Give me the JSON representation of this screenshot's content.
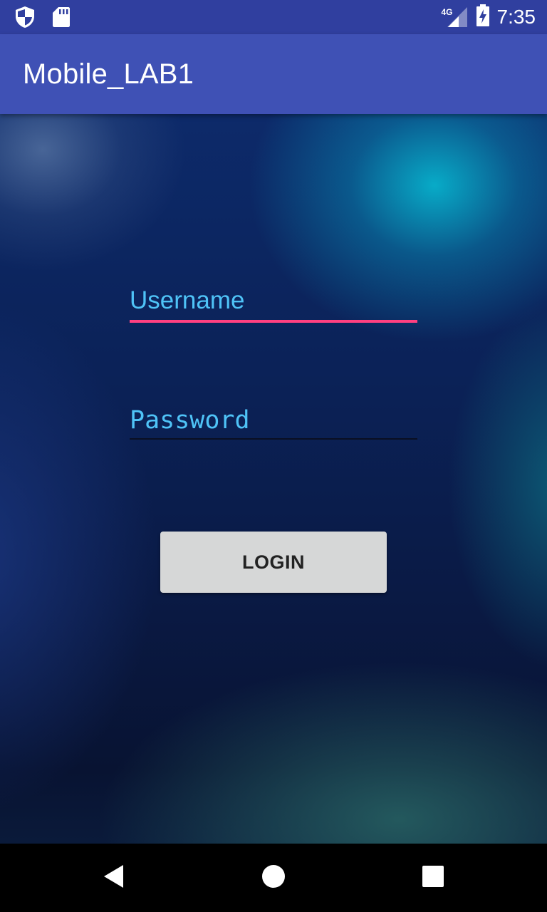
{
  "status_bar": {
    "time": "7:35",
    "network_label": "4G",
    "icons": [
      "shield-icon",
      "sd-card-icon",
      "signal-icon",
      "battery-charging-icon"
    ]
  },
  "app_bar": {
    "title": "Mobile_LAB1",
    "color": "#3f51b5"
  },
  "login_form": {
    "username": {
      "placeholder": "Username",
      "value": "",
      "underline_color": "#ff4081"
    },
    "password": {
      "placeholder": "Password",
      "value": ""
    },
    "login_button_label": "LOGIN",
    "hint_color": "#4fc3f7"
  },
  "nav_bar": {
    "icons": [
      "back-icon",
      "home-icon",
      "recents-icon"
    ]
  }
}
